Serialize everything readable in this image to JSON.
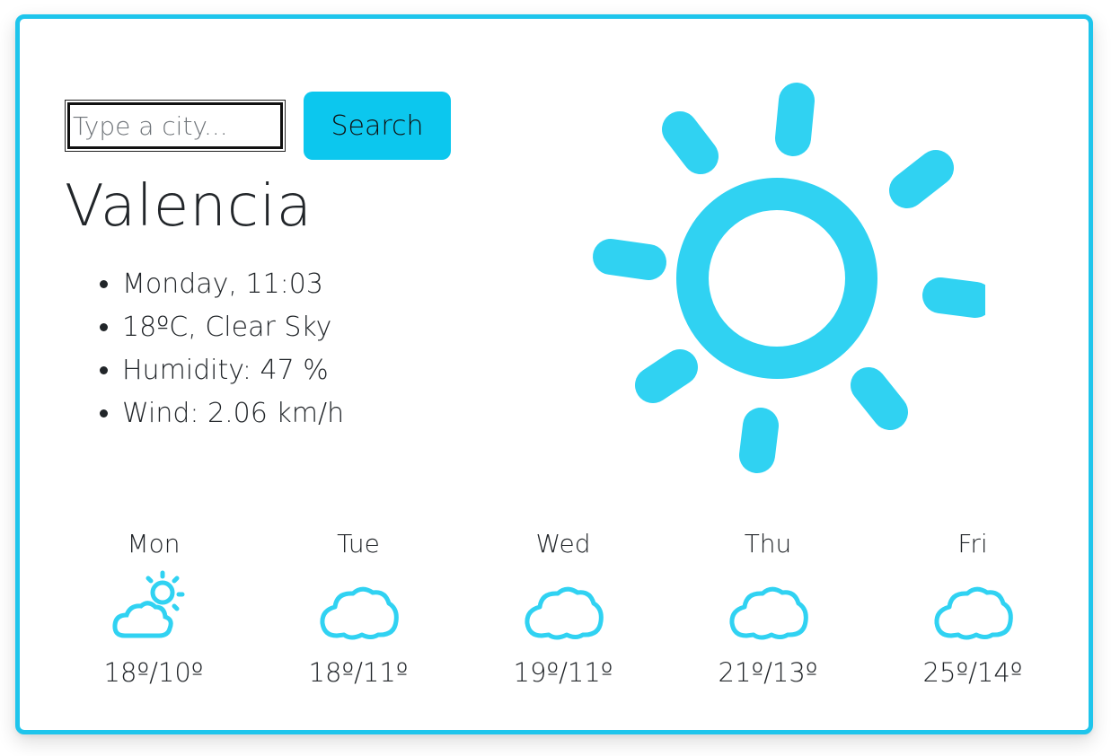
{
  "colors": {
    "accent": "#0cc7ee",
    "border": "#1ec5ec",
    "icon": "#30d2f2",
    "text": "#212529"
  },
  "search": {
    "placeholder": "Type a city...",
    "value": "",
    "button_label": "Search"
  },
  "current": {
    "city": "Valencia",
    "datetime": "Monday, 11:03",
    "temp_condition": "18ºC, Clear Sky",
    "humidity": "Humidity: 47 %",
    "wind": "Wind: 2.06 km/h",
    "icon": "sun-icon"
  },
  "forecast": [
    {
      "day": "Mon",
      "temps": "18º/10º",
      "icon": "partly-cloudy-icon"
    },
    {
      "day": "Tue",
      "temps": "18º/11º",
      "icon": "cloud-icon"
    },
    {
      "day": "Wed",
      "temps": "19º/11º",
      "icon": "cloud-icon"
    },
    {
      "day": "Thu",
      "temps": "21º/13º",
      "icon": "cloud-icon"
    },
    {
      "day": "Fri",
      "temps": "25º/14º",
      "icon": "cloud-icon"
    }
  ]
}
